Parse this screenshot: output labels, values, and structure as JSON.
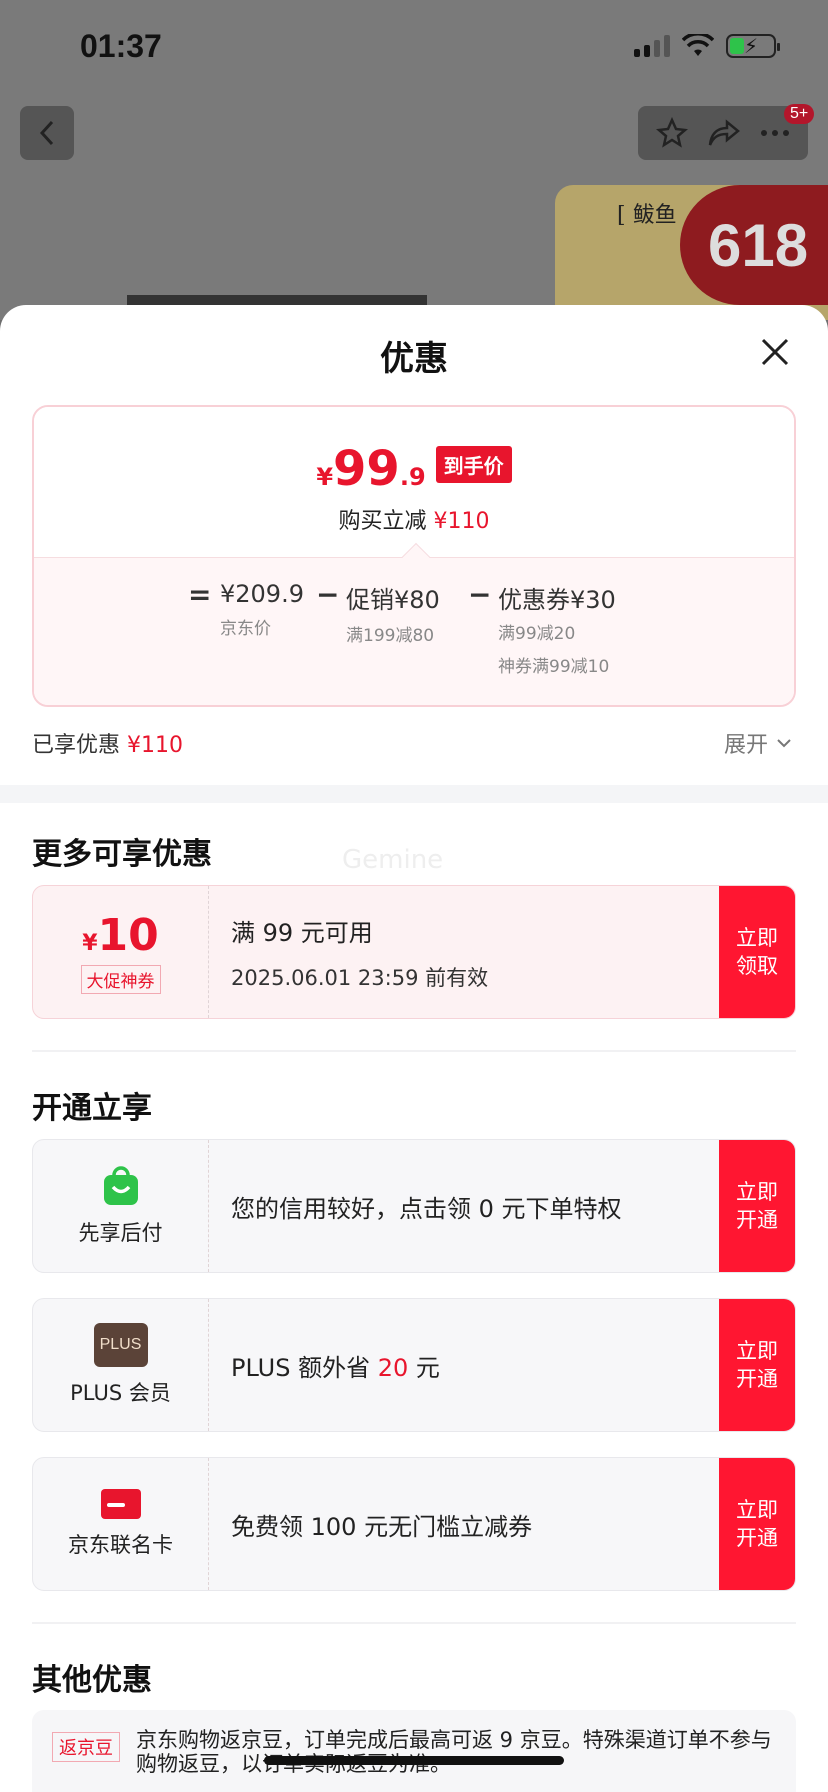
{
  "status_bar": {
    "time": "01:37"
  },
  "background_page": {
    "badge": "5+",
    "promo_text": "[ 鲅鱼",
    "promo_big": "618"
  },
  "sheet": {
    "title": "优惠"
  },
  "price_summary": {
    "currency_symbol": "¥",
    "final_price_int": "99",
    "final_price_dec": ".9",
    "final_price_tag": "到手价",
    "save_label": "购买立减",
    "save_amount": "¥110",
    "breakdown": {
      "eq": "=",
      "jd_price": "¥209.9",
      "jd_price_label": "京东价",
      "minus1": "−",
      "promo_label": "促销¥80",
      "promo_detail": "满199减80",
      "minus2": "−",
      "coupon_label": "优惠券¥30",
      "coupon_detail_1": "满99减20",
      "coupon_detail_2": "神券满99减10"
    }
  },
  "enjoyed": {
    "label": "已享优惠",
    "amount": "¥110",
    "expand": "展开"
  },
  "more_offers": {
    "title": "更多可享优惠",
    "watermark": "Gemine",
    "coupon": {
      "symbol": "¥",
      "amount": "10",
      "tag": "大促神券",
      "condition": "满 99 元可用",
      "expiry": "2025.06.01 23:59 前有效",
      "button_line1": "立即",
      "button_line2": "领取"
    }
  },
  "activate": {
    "title": "开通立享",
    "items": [
      {
        "name": "先享后付",
        "icon": "shopping-bag-icon",
        "text": "您的信用较好，点击领 0 元下单特权",
        "button_line1": "立即",
        "button_line2": "开通"
      },
      {
        "name": "PLUS 会员",
        "icon": "plus-logo",
        "logo_text": "PLUS",
        "text_before": "PLUS 额外省 ",
        "text_highlight": "20",
        "text_after": " 元",
        "button_line1": "立即",
        "button_line2": "开通"
      },
      {
        "name": "京东联名卡",
        "icon": "credit-card-icon",
        "text": "免费领 100 元无门槛立减券",
        "button_line1": "立即",
        "button_line2": "开通"
      }
    ]
  },
  "other": {
    "title": "其他优惠",
    "tag": "返京豆",
    "text": "京东购物返京豆，订单完成后最高可返 9 京豆。特殊渠道订单不参与购物返豆，以订单实际返豆为准。"
  },
  "colors": {
    "accent": "#e8152d",
    "button": "#ff1631",
    "green": "#2ec34a"
  }
}
